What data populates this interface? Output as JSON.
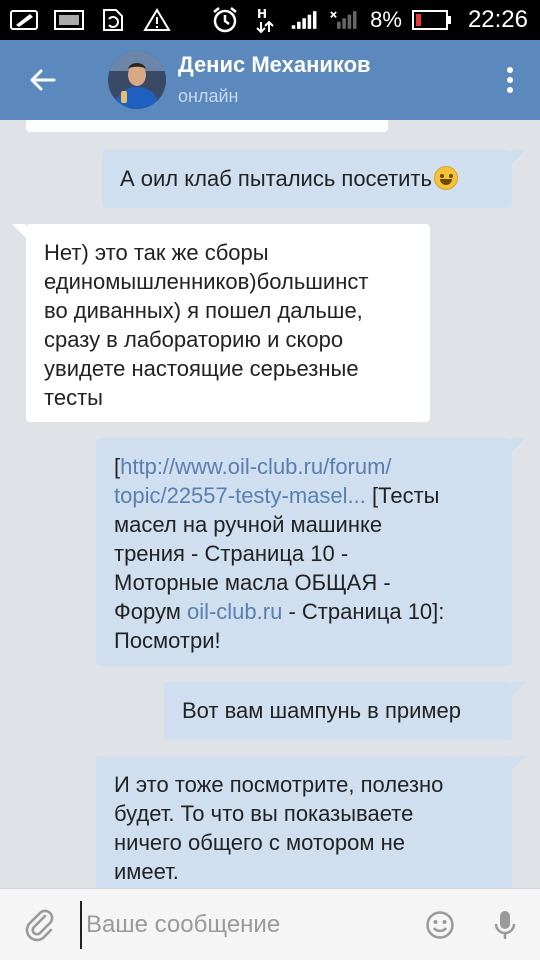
{
  "status_bar": {
    "battery": "8%",
    "time": "22:26"
  },
  "header": {
    "contact_name": "Денис Механиков",
    "contact_status": "онлайн"
  },
  "messages": [
    {
      "direction": "out",
      "text": "А оил клаб пытались посетить",
      "emoji": "grinning-face-emoji"
    },
    {
      "direction": "in",
      "lines": [
        "Нет) это так же сборы",
        "единомышленников)большинст",
        "во диванных) я пошел дальше,",
        "сразу в лабораторию и скоро",
        "увидете настоящие серьезные",
        "тесты"
      ]
    },
    {
      "direction": "out",
      "parts": {
        "open_bracket": "[",
        "link1_line1": "http://www.oil-club.ru/forum/",
        "link1_line2": "topic/22557-testy-masel...",
        "after_link1": " [Тесты",
        "line3": "масел на ручной машинке",
        "line4": "трения - Страница 10 -",
        "line5": "Моторные масла ОБЩАЯ -",
        "before_link2": "Форум ",
        "link2": "oil-club.ru",
        "after_link2": " - Страница 10]:",
        "line7": "Посмотри!"
      }
    },
    {
      "direction": "out",
      "text": "Вот вам шампунь в пример"
    },
    {
      "direction": "out",
      "lines": [
        "И это тоже посмотрите, полезно",
        "будет. То что вы показываете",
        "ничего общего с мотором не",
        "имеет."
      ]
    }
  ],
  "input": {
    "placeholder": "Ваше сообщение"
  }
}
